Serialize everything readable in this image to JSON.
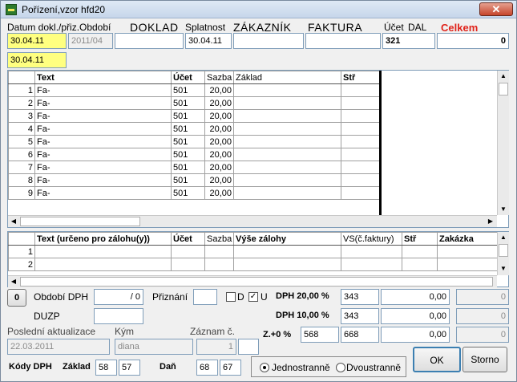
{
  "window": {
    "title": "Pořízení,vzor hfd20",
    "close": "✕"
  },
  "header": {
    "datum_label": "Datum dokl./přiz.",
    "obdobi_label": "Období",
    "doklad_label": "DOKLAD",
    "splatnost_label": "Splatnost",
    "zakaznik_label": "ZÁKAZNÍK",
    "faktura_label": "FAKTURA",
    "ucet_label": "Účet",
    "dal_label": "DAL",
    "celkem_label": "Celkem",
    "datum_value": "30.04.11",
    "obdobi_value": "2011/04",
    "doklad_value": "",
    "splatnost_value": "30.04.11",
    "zakaznik_value": "",
    "faktura_value": "",
    "ucet_value": "321",
    "celkem_value": "0",
    "date2_value": "30.04.11"
  },
  "grid1": {
    "columns": [
      "",
      "Text",
      "Účet",
      "Sazba",
      "Základ",
      "Stř"
    ],
    "rows": [
      {
        "n": "1",
        "text": "Fa-",
        "ucet": "501",
        "sazba": "20,00"
      },
      {
        "n": "2",
        "text": "Fa-",
        "ucet": "501",
        "sazba": "20,00"
      },
      {
        "n": "3",
        "text": "Fa-",
        "ucet": "501",
        "sazba": "20,00"
      },
      {
        "n": "4",
        "text": "Fa-",
        "ucet": "501",
        "sazba": "20,00"
      },
      {
        "n": "5",
        "text": "Fa-",
        "ucet": "501",
        "sazba": "20,00"
      },
      {
        "n": "6",
        "text": "Fa-",
        "ucet": "501",
        "sazba": "20,00"
      },
      {
        "n": "7",
        "text": "Fa-",
        "ucet": "501",
        "sazba": "20,00"
      },
      {
        "n": "8",
        "text": "Fa-",
        "ucet": "501",
        "sazba": "20,00"
      },
      {
        "n": "9",
        "text": "Fa-",
        "ucet": "501",
        "sazba": "20,00"
      }
    ]
  },
  "grid2": {
    "columns": [
      "",
      "Text (určeno pro zálohu(y))",
      "Účet",
      "Sazba",
      "Výše zálohy",
      "VS(č.faktury)",
      "Stř",
      "Zakázka"
    ],
    "rows": [
      {
        "n": "1"
      },
      {
        "n": "2"
      }
    ]
  },
  "bottom": {
    "zero_btn": "0",
    "obdobi_dph_label": "Období DPH",
    "obdobi_dph_value": "/ 0",
    "priznani_label": "Přiznání",
    "priznani_value": "",
    "d_label": "D",
    "u_label": "U",
    "u_check": "✓",
    "duzp_label": "DUZP",
    "duzp_value": "",
    "posl_label": "Poslední aktualizace",
    "kym_label": "Kým",
    "zaznam_label": "Záznam č.",
    "posl_value": "22.03.2011",
    "kym_value": "diana",
    "zaznam_value": "1",
    "zaznam_extra": "",
    "kody_label": "Kódy DPH",
    "zaklad_label": "Základ",
    "zaklad1": "58",
    "zaklad2": "57",
    "dan_label": "Daň",
    "dan1": "68",
    "dan2": "67",
    "jedno_label": "Jednostranně",
    "dvou_label": "Dvoustranně",
    "ok": "OK",
    "storno": "Storno",
    "dph20_label": "DPH 20,00 %",
    "dph20_ucet": "343",
    "dph20_val": "0,00",
    "dph20_grey": "0",
    "dph10_label": "DPH 10,00 %",
    "dph10_ucet": "343",
    "dph10_val": "0,00",
    "dph10_grey": "0",
    "z0_label": "Z.+0 %",
    "z0_ucet1": "568",
    "z0_ucet2": "668",
    "z0_val": "0,00",
    "z0_grey": "0"
  }
}
